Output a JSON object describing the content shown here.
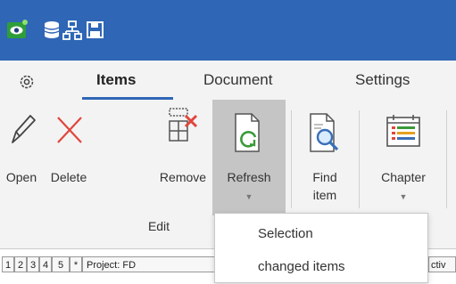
{
  "quick_access": {
    "icons": [
      "app-logo-icon",
      "database-icon",
      "network-icon",
      "save-icon"
    ]
  },
  "menu": {
    "tabs": [
      {
        "label": "Items",
        "active": true
      },
      {
        "label": "Document",
        "active": false
      },
      {
        "label": "Settings",
        "active": false
      }
    ]
  },
  "ribbon": {
    "buttons": {
      "open": "Open",
      "delete": "Delete",
      "remove": "Remove",
      "refresh": "Refresh",
      "find_item_line1": "Find",
      "find_item_line2": "item",
      "chapter": "Chapter"
    },
    "group_label": "Edit"
  },
  "grid_header": {
    "cells": [
      "1",
      "2",
      "3",
      "4",
      "5",
      "*"
    ],
    "project_label": "Project: FD",
    "col_partial": "ctiv"
  },
  "refresh_dropdown": {
    "items": [
      "Selection",
      "changed items"
    ]
  },
  "colors": {
    "title_bar": "#2f66b5",
    "ribbon_bg": "#f3f3f3",
    "pressed_bg": "#c5c5c5",
    "delete_red": "#e0463c",
    "refresh_green": "#3a9a3a"
  }
}
